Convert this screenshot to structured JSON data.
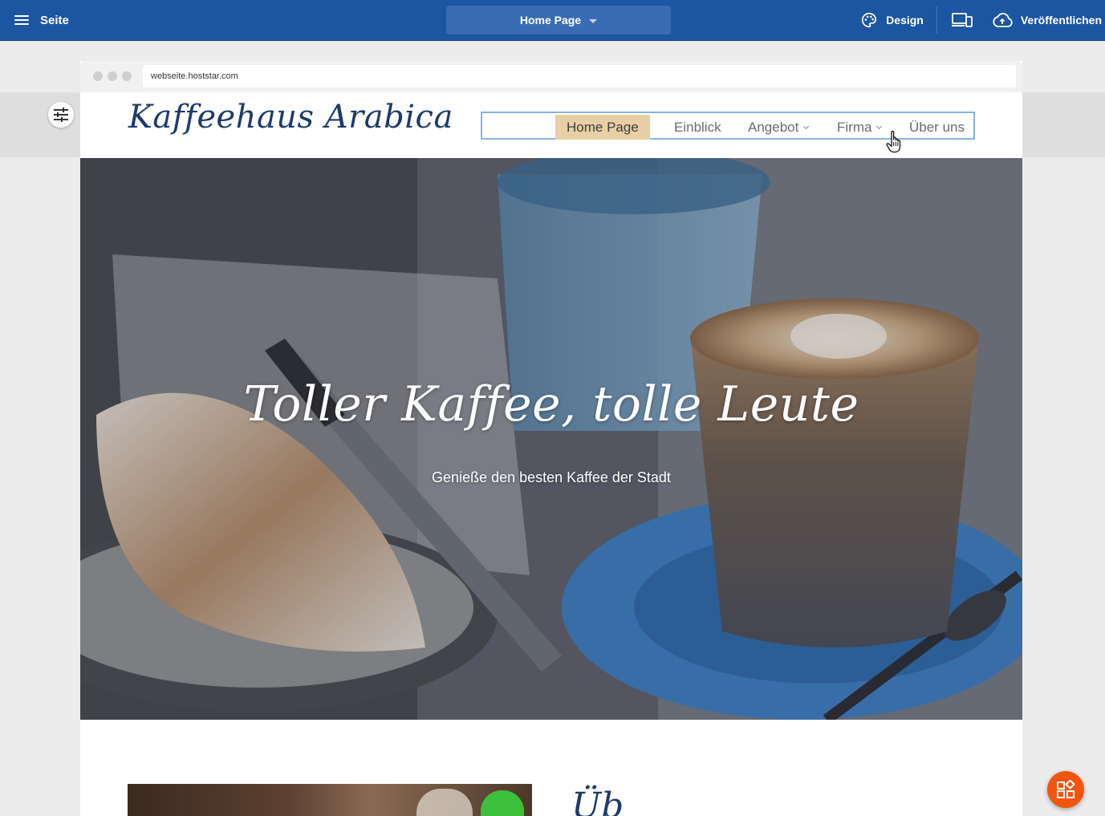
{
  "toolbar": {
    "menu_label": "Seite",
    "page_select_label": "Home Page",
    "design_label": "Design",
    "publish_label": "Veröffentlichen"
  },
  "browser": {
    "url": "webseite.hoststar.com"
  },
  "site": {
    "logo": "Kaffeehaus Arabica",
    "nav": [
      {
        "label": "Home Page",
        "active": true
      },
      {
        "label": "Einblick"
      },
      {
        "label": "Angebot",
        "has_submenu": true
      },
      {
        "label": "Firma",
        "has_submenu": true
      },
      {
        "label": "Über uns"
      }
    ],
    "active_nav_color": "#e8cfa5",
    "nav_outline_color": "#86b2ea"
  },
  "hero": {
    "title": "Toller Kaffee, tolle Leute",
    "subtitle": "Genieße den besten Kaffee der Stadt"
  },
  "below": {
    "partial_heading": "Üb"
  },
  "colors": {
    "toolbar_bg": "#1c56a3",
    "fab_bg": "#f2550f",
    "logo_color": "#1e3a6b"
  },
  "icons": {
    "menu": "hamburger-icon",
    "page_caret": "caret-down-icon",
    "design": "palette-icon",
    "devices": "devices-icon",
    "publish": "cloud-upload-icon",
    "settings": "tune-sliders-icon",
    "cursor": "hand-pointer-icon",
    "fab": "widgets-icon"
  }
}
